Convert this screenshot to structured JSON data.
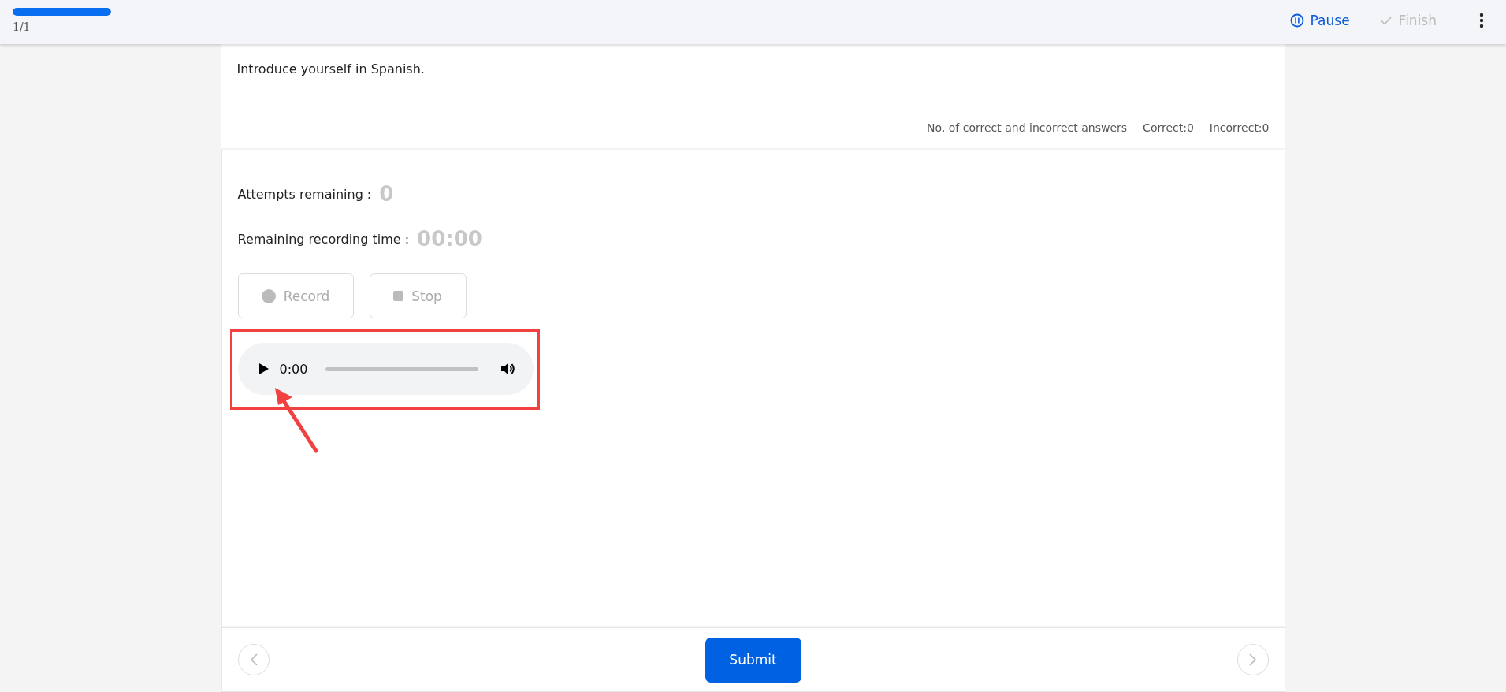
{
  "progress": {
    "level": 1,
    "counter": "1/1"
  },
  "header_actions": [
    {
      "kind": "pause",
      "label": "Pause",
      "disabled": false
    },
    {
      "kind": "finish",
      "label": "Finish",
      "disabled": true
    }
  ],
  "question": {
    "text": "Introduce yourself in Spanish.",
    "stats_label": "No. of correct and incorrect answers",
    "correct": "Correct:0",
    "incorrect": "Incorrect:0"
  },
  "attempts": {
    "label": "Attempts remaining :",
    "value": "0"
  },
  "recording_time": {
    "label": "Remaining recording time :",
    "value": "00:00"
  },
  "record_buttons": [
    {
      "kind": "record",
      "label": "Record",
      "disabled": true
    },
    {
      "kind": "stop",
      "label": "Stop",
      "disabled": true
    }
  ],
  "audio_player": {
    "time": "0:00"
  },
  "footer": {
    "submit": "Submit",
    "prev_disabled": true,
    "next_disabled": true
  }
}
